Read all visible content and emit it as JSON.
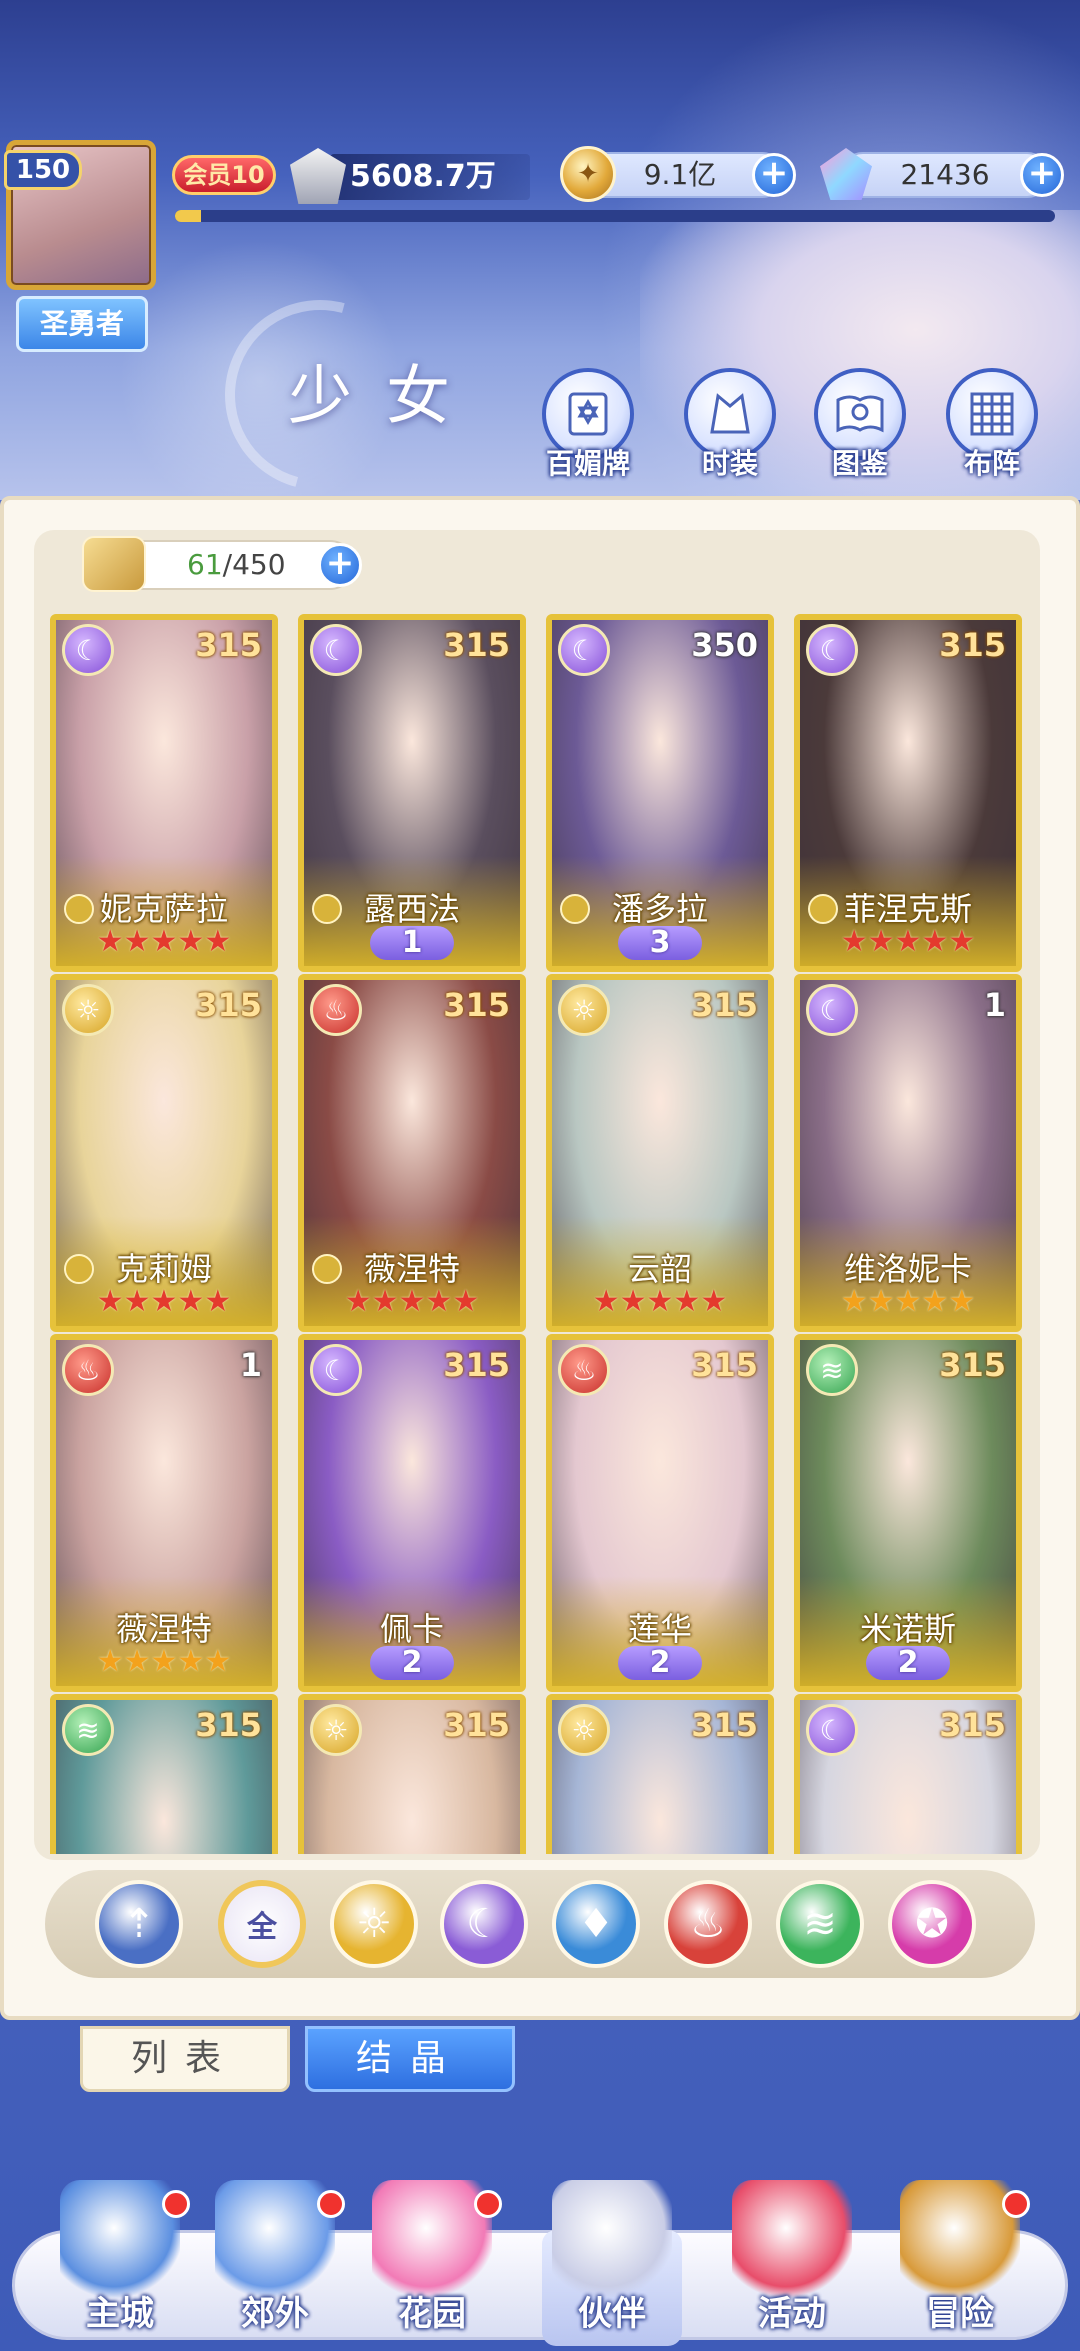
{
  "player": {
    "level": "150",
    "title": "圣勇者",
    "vip": "会员10",
    "power": "5608.7万",
    "exp_fraction": 0.03
  },
  "currency": {
    "gold": "9.1亿",
    "gems": "21436"
  },
  "page": {
    "title": "少女"
  },
  "top_buttons": [
    {
      "label": "百媚牌",
      "icon": "card-deck-icon"
    },
    {
      "label": "时装",
      "icon": "costume-icon"
    },
    {
      "label": "图鉴",
      "icon": "book-icon"
    },
    {
      "label": "布阵",
      "icon": "formation-grid-icon"
    }
  ],
  "inventory": {
    "current": "61",
    "max": "/450"
  },
  "cards": [
    {
      "name": "妮克萨拉",
      "level": "315",
      "element": "moon",
      "stars": 5,
      "star_color": "red",
      "rank": null,
      "has_pawn": true,
      "bg": "#c9a0a8"
    },
    {
      "name": "露西法",
      "level": "315",
      "element": "moon",
      "stars": 0,
      "star_color": "red",
      "rank": "1",
      "has_pawn": true,
      "bg": "#5a4e5e"
    },
    {
      "name": "潘多拉",
      "level": "350",
      "element": "moon",
      "stars": 0,
      "star_color": "red",
      "rank": "3",
      "has_pawn": true,
      "bg": "#6c5a96"
    },
    {
      "name": "菲涅克斯",
      "level": "315",
      "element": "moon",
      "stars": 5,
      "star_color": "red",
      "rank": null,
      "has_pawn": true,
      "bg": "#4b3a3a"
    },
    {
      "name": "克莉姆",
      "level": "315",
      "element": "sun",
      "stars": 5,
      "star_color": "red",
      "rank": null,
      "has_pawn": true,
      "bg": "#e8d49a"
    },
    {
      "name": "薇涅特",
      "level": "315",
      "element": "fire",
      "stars": 5,
      "star_color": "red",
      "rank": null,
      "has_pawn": true,
      "bg": "#8a4b46"
    },
    {
      "name": "云韶",
      "level": "315",
      "element": "sun",
      "stars": 5,
      "star_color": "red",
      "rank": null,
      "has_pawn": false,
      "bg": "#b9c7c2"
    },
    {
      "name": "维洛妮卡",
      "level": "1",
      "element": "moon",
      "stars": 5,
      "star_color": "gold",
      "rank": null,
      "has_pawn": false,
      "bg": "#8a6e88"
    },
    {
      "name": "薇涅特",
      "level": "1",
      "element": "fire",
      "stars": 5,
      "star_color": "gold",
      "rank": null,
      "has_pawn": false,
      "bg": "#caa3a0"
    },
    {
      "name": "佩卡",
      "level": "315",
      "element": "moon",
      "stars": 0,
      "star_color": "red",
      "rank": "2",
      "has_pawn": false,
      "bg": "#8a5cc4"
    },
    {
      "name": "莲华",
      "level": "315",
      "element": "fire",
      "stars": 0,
      "star_color": "red",
      "rank": "2",
      "has_pawn": false,
      "bg": "#e4c8d0"
    },
    {
      "name": "米诺斯",
      "level": "315",
      "element": "wind",
      "stars": 0,
      "star_color": "red",
      "rank": "2",
      "has_pawn": false,
      "bg": "#6d8b5c"
    },
    {
      "name": "",
      "level": "315",
      "element": "wind",
      "stars": 0,
      "star_color": "red",
      "rank": null,
      "has_pawn": false,
      "bg": "#5f9a9a"
    },
    {
      "name": "",
      "level": "315",
      "element": "sun",
      "stars": 0,
      "star_color": "red",
      "rank": null,
      "has_pawn": false,
      "bg": "#d8b8a0"
    },
    {
      "name": "",
      "level": "315",
      "element": "sun",
      "stars": 0,
      "star_color": "red",
      "rank": null,
      "has_pawn": false,
      "bg": "#a6b6d6"
    },
    {
      "name": "",
      "level": "315",
      "element": "moon",
      "stars": 0,
      "star_color": "red",
      "rank": null,
      "has_pawn": false,
      "bg": "#d6d6e0"
    }
  ],
  "filters": [
    {
      "icon": "sort-up-icon",
      "label": "",
      "color": "#4a6fc4"
    },
    {
      "icon": "all-icon",
      "label": "全",
      "color": "#ffffff"
    },
    {
      "icon": "sun-icon",
      "label": "",
      "color": "#e6b430"
    },
    {
      "icon": "moon-icon",
      "label": "",
      "color": "#8a5cd6"
    },
    {
      "icon": "water-icon",
      "label": "",
      "color": "#3a8bd8"
    },
    {
      "icon": "fire-icon",
      "label": "",
      "color": "#d8423a"
    },
    {
      "icon": "wind-icon",
      "label": "",
      "color": "#3cb45c"
    },
    {
      "icon": "star-orbit-icon",
      "label": "",
      "color": "#d63caa"
    }
  ],
  "tabs": {
    "list": "列表",
    "crystal": "结晶"
  },
  "nav": [
    {
      "label": "主城",
      "icon": "castle-icon",
      "dot": true
    },
    {
      "label": "郊外",
      "icon": "portal-icon",
      "dot": true
    },
    {
      "label": "花园",
      "icon": "heart-icon",
      "dot": true
    },
    {
      "label": "伙伴",
      "icon": "partner-icon",
      "dot": false,
      "active": true
    },
    {
      "label": "活动",
      "icon": "gift-icon",
      "dot": false
    },
    {
      "label": "冒险",
      "icon": "compass-icon",
      "dot": true
    }
  ]
}
